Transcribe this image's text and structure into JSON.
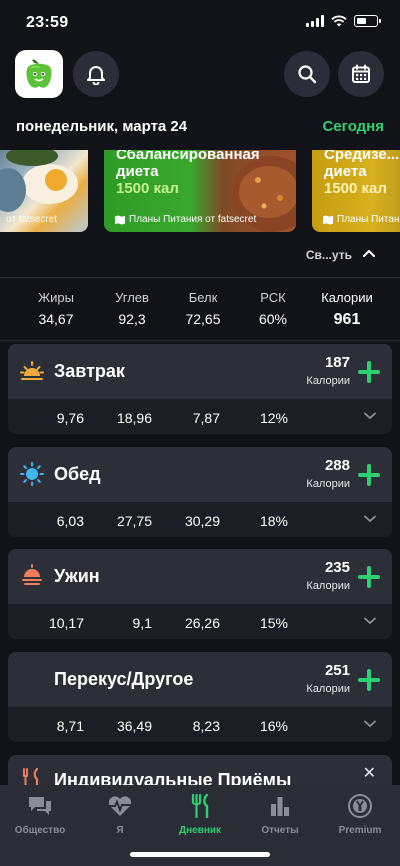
{
  "status_bar": {
    "time": "23:59"
  },
  "header": {
    "date": "понедельник, марта 24",
    "today_label": "Сегодня"
  },
  "banners": [
    {
      "title": "",
      "calories": "",
      "source": "от fatsecret"
    },
    {
      "title": "Сбалансированная диета",
      "calories": "1500 кал",
      "source": "Планы Питания от fatsecret"
    },
    {
      "title": "Средизе... я диета",
      "calories": "1500 кал",
      "source": "Планы Питания"
    }
  ],
  "collapse_label": "Св...уть",
  "totals": {
    "columns": [
      "Жиры",
      "Углев",
      "Белк",
      "РСК",
      "Калории"
    ],
    "values": [
      "34,67",
      "92,3",
      "72,65",
      "60%",
      "961"
    ]
  },
  "calories_unit": "Калории",
  "meals": [
    {
      "name": "Завтрак",
      "calories": "187",
      "values": [
        "9,76",
        "18,96",
        "7,87",
        "12%"
      ],
      "icon": "sunrise-icon",
      "icon_color": "#f2a93b"
    },
    {
      "name": "Обед",
      "calories": "288",
      "values": [
        "6,03",
        "27,75",
        "30,29",
        "18%"
      ],
      "icon": "sun-icon",
      "icon_color": "#3fb6f2"
    },
    {
      "name": "Ужин",
      "calories": "235",
      "values": [
        "10,17",
        "9,1",
        "26,26",
        "15%"
      ],
      "icon": "sunset-icon",
      "icon_color": "#f07d5a"
    },
    {
      "name": "Перекус/Другое",
      "calories": "251",
      "values": [
        "8,71",
        "36,49",
        "8,23",
        "16%"
      ],
      "icon": "moon-icon",
      "icon_color": "#8e6bd8"
    }
  ],
  "individual_meals": {
    "name": "Индивидуальные Приёмы",
    "close": "✕"
  },
  "tabs": [
    {
      "label": "Общество",
      "icon": "chat-bubbles-icon",
      "active": false
    },
    {
      "label": "Я",
      "icon": "heart-pulse-icon",
      "active": false
    },
    {
      "label": "Дневник",
      "icon": "fork-knife-icon",
      "active": true
    },
    {
      "label": "Отчеты",
      "icon": "bar-chart-icon",
      "active": false
    },
    {
      "label": "Premium",
      "icon": "premium-badge-icon",
      "active": false
    }
  ],
  "colors": {
    "accent": "#2ecf71",
    "background": "#121319",
    "card": "#2c2f38",
    "tabbar": "#2a2d35"
  }
}
